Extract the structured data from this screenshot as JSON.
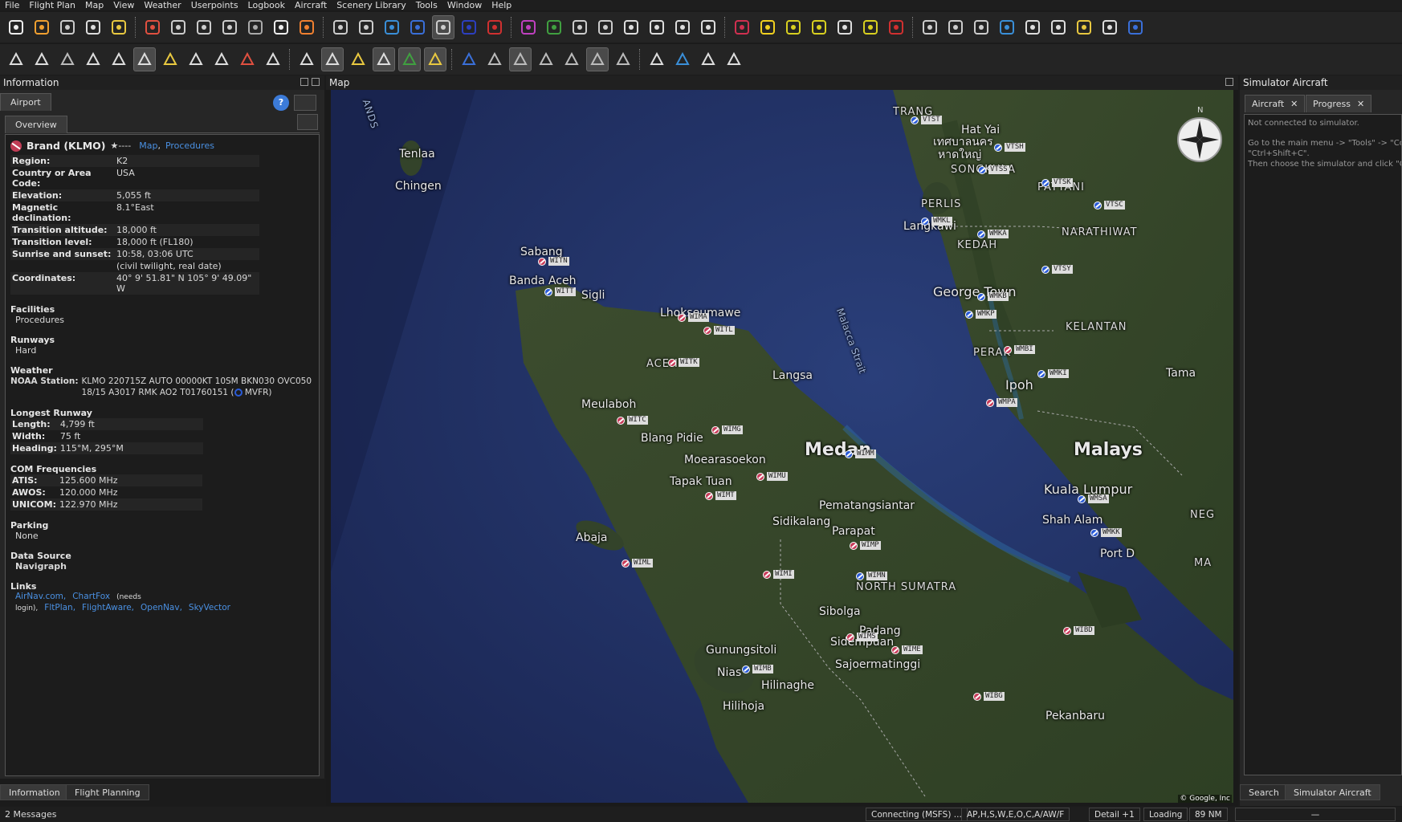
{
  "menu": [
    "File",
    "Flight Plan",
    "Map",
    "View",
    "Weather",
    "Userpoints",
    "Logbook",
    "Aircraft",
    "Scenery Library",
    "Tools",
    "Window",
    "Help"
  ],
  "left_dock": {
    "title": "Information",
    "tab_airport": "Airport",
    "tab_overview": "Overview",
    "airport_name": "Brand (KLMO)",
    "rating": "★----",
    "link_map": "Map",
    "link_sep": ",",
    "link_procedures": "Procedures",
    "rows": [
      {
        "k": "Region:",
        "v": "K2"
      },
      {
        "k": "Country or Area Code:",
        "v": "USA"
      },
      {
        "k": "Elevation:",
        "v": "5,055 ft"
      },
      {
        "k": "Magnetic declination:",
        "v": "8.1°East"
      },
      {
        "k": "Transition altitude:",
        "v": "18,000 ft"
      },
      {
        "k": "Transition level:",
        "v": "18,000 ft (FL180)"
      },
      {
        "k": "Sunrise and sunset:",
        "v": "10:58, 03:06 UTC"
      },
      {
        "k": "",
        "v": "(civil twilight, real date)"
      },
      {
        "k": "Coordinates:",
        "v": "40° 9' 51.81\" N 105° 9' 49.09\" W"
      }
    ],
    "facilities_h": "Facilities",
    "facilities_v": "Procedures",
    "runways_h": "Runways",
    "runways_v": "Hard",
    "weather_h": "Weather",
    "noaa_k": "NOAA Station:",
    "noaa_v": "KLMO 220715Z AUTO 00000KT 10SM BKN030 OVC050 18/15 A3017 RMK AO2 T01760151",
    "mvfr": "MVFR)",
    "longest_h": "Longest Runway",
    "longest": [
      {
        "k": "Length:",
        "v": "4,799 ft"
      },
      {
        "k": "Width:",
        "v": "75 ft"
      },
      {
        "k": "Heading:",
        "v": "115°M, 295°M"
      }
    ],
    "com_h": "COM Frequencies",
    "com": [
      {
        "k": "ATIS:",
        "v": "125.600 MHz"
      },
      {
        "k": "AWOS:",
        "v": "120.000 MHz"
      },
      {
        "k": "UNICOM:",
        "v": "122.970 MHz"
      }
    ],
    "parking_h": "Parking",
    "parking_v": "None",
    "source_h": "Data Source",
    "source_v": "Navigraph",
    "links_h": "Links",
    "links": [
      "AirNav.com,",
      "ChartFox",
      "(needs login),",
      "FltPlan,",
      "FlightAware,",
      "OpenNav,",
      "SkyVector"
    ],
    "bottom_tab1": "Information",
    "bottom_tab2": "Flight Planning"
  },
  "map_dock": {
    "title": "Map",
    "compass_n": "N",
    "copyright": "© Google, Inc",
    "cities": [
      {
        "t": "TRANG",
        "c": "reg"
      },
      {
        "t": "Hat Yai",
        "c": ""
      },
      {
        "t": "เทศบาลนคร",
        "c": ""
      },
      {
        "t": "หาดใหญ่",
        "c": ""
      },
      {
        "t": "SONGKHLA",
        "c": "reg"
      },
      {
        "t": "PATTANI",
        "c": "reg"
      },
      {
        "t": "PERLIS",
        "c": "reg"
      },
      {
        "t": "NARATHIWAT",
        "c": "reg"
      },
      {
        "t": "Langkawi",
        "c": ""
      },
      {
        "t": "KEDAH",
        "c": "reg"
      },
      {
        "t": "George Town",
        "c": "med"
      },
      {
        "t": "KELANTAN",
        "c": "reg"
      },
      {
        "t": "Malacca Strait",
        "c": ""
      },
      {
        "t": "PERAK",
        "c": "reg"
      },
      {
        "t": "Ipoh",
        "c": "med"
      },
      {
        "t": "Tama",
        "c": ""
      },
      {
        "t": "Malays",
        "c": "big"
      },
      {
        "t": "Kuala Lumpur",
        "c": "med"
      },
      {
        "t": "Shah Alam",
        "c": ""
      },
      {
        "t": "Port D",
        "c": ""
      },
      {
        "t": "Tenlaa",
        "c": ""
      },
      {
        "t": "Chingen",
        "c": ""
      },
      {
        "t": "ANDS",
        "c": "reg"
      },
      {
        "t": "Sabang",
        "c": ""
      },
      {
        "t": "Banda Aceh",
        "c": ""
      },
      {
        "t": "Sigli",
        "c": ""
      },
      {
        "t": "Lhokseumawe",
        "c": ""
      },
      {
        "t": "ACEH",
        "c": "reg"
      },
      {
        "t": "Langsa",
        "c": ""
      },
      {
        "t": "Meulaboh",
        "c": ""
      },
      {
        "t": "Blang Pidie",
        "c": ""
      },
      {
        "t": "Medan",
        "c": "big"
      },
      {
        "t": "Moearasoekon",
        "c": ""
      },
      {
        "t": "Tapak Tuan",
        "c": ""
      },
      {
        "t": "Pematangsiantar",
        "c": ""
      },
      {
        "t": "Sidikalang",
        "c": ""
      },
      {
        "t": "Parapat",
        "c": ""
      },
      {
        "t": "Abaja",
        "c": ""
      },
      {
        "t": "NORTH SUMATRA",
        "c": "reg"
      },
      {
        "t": "Sibolga",
        "c": ""
      },
      {
        "t": "Padang",
        "c": ""
      },
      {
        "t": "Sidempuan",
        "c": ""
      },
      {
        "t": "Gunungsitoli",
        "c": ""
      },
      {
        "t": "Nias",
        "c": ""
      },
      {
        "t": "Hilinaghe",
        "c": ""
      },
      {
        "t": "Sajoermatinggi",
        "c": ""
      },
      {
        "t": "Hilihoja",
        "c": ""
      },
      {
        "t": "Pekanbaru",
        "c": ""
      },
      {
        "t": "NEG",
        "c": "reg"
      },
      {
        "t": "MA",
        "c": "reg"
      }
    ],
    "airports": [
      {
        "id": "VTST",
        "blue": true
      },
      {
        "id": "VTSH",
        "blue": true
      },
      {
        "id": "VTSS",
        "blue": true
      },
      {
        "id": "VTSK",
        "blue": true
      },
      {
        "id": "VTSC",
        "blue": true
      },
      {
        "id": "WMKL",
        "blue": true
      },
      {
        "id": "WMKA",
        "blue": true
      },
      {
        "id": "VTSY",
        "blue": true
      },
      {
        "id": "WMKB",
        "blue": true
      },
      {
        "id": "WMKP",
        "blue": true
      },
      {
        "id": "WMBI",
        "blue": false
      },
      {
        "id": "WMKI",
        "blue": true
      },
      {
        "id": "WMPA",
        "blue": false
      },
      {
        "id": "WMSA",
        "blue": true
      },
      {
        "id": "WMKK",
        "blue": true
      },
      {
        "id": "WITN",
        "blue": false
      },
      {
        "id": "WITT",
        "blue": true
      },
      {
        "id": "WIMA",
        "blue": false
      },
      {
        "id": "WITL",
        "blue": false
      },
      {
        "id": "WITK",
        "blue": false
      },
      {
        "id": "WITC",
        "blue": false
      },
      {
        "id": "WIMG",
        "blue": false
      },
      {
        "id": "WIMM",
        "blue": true
      },
      {
        "id": "WIMU",
        "blue": false
      },
      {
        "id": "WIMT",
        "blue": false
      },
      {
        "id": "WIMP",
        "blue": false
      },
      {
        "id": "WIML",
        "blue": false
      },
      {
        "id": "WIMI",
        "blue": false
      },
      {
        "id": "WIMN",
        "blue": true
      },
      {
        "id": "WIMS",
        "blue": false
      },
      {
        "id": "WIME",
        "blue": false
      },
      {
        "id": "WIMB",
        "blue": true
      },
      {
        "id": "WIBG",
        "blue": false
      },
      {
        "id": "WIBD",
        "blue": false
      }
    ]
  },
  "right_dock": {
    "title": "Simulator Aircraft",
    "tab_aircraft": "Aircraft",
    "tab_progress": "Progress",
    "msg1": "Not connected to simulator.",
    "msg2": "Go to the main menu -> \"Tools\" -> \"Co",
    "msg3": "\"Ctrl+Shift+C\".",
    "msg4": "Then choose the simulator and click \"Co",
    "bottom_tab1": "Search",
    "bottom_tab2": "Simulator Aircraft"
  },
  "status": {
    "messages": "2 Messages",
    "connecting": "Connecting (MSFS) ...",
    "filter": "AP,H,S,W,E,O,C,A/AW/F",
    "detail": "Detail +1",
    "loading": "Loading",
    "distance": "89 NM",
    "dash": "—"
  }
}
